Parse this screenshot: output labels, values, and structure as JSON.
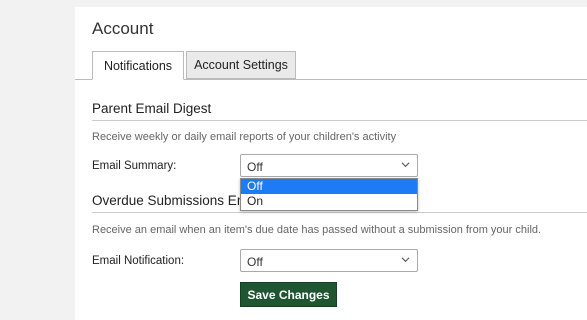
{
  "page": {
    "title": "Account"
  },
  "tabs": [
    {
      "label": "Notifications",
      "active": true
    },
    {
      "label": "Account Settings",
      "active": false
    }
  ],
  "sections": [
    {
      "title": "Parent Email Digest",
      "help": "Receive weekly or daily email reports of your children's activity",
      "field_label": "Email Summary:",
      "select_value": "Off"
    },
    {
      "title": "Overdue Submissions Email",
      "help": "Receive an email when an item's due date has passed without a submission from your child.",
      "field_label": "Email Notification:",
      "select_value": "Off"
    }
  ],
  "dropdown": {
    "options": [
      {
        "label": "Off",
        "highlighted": true
      },
      {
        "label": "On",
        "highlighted": false
      }
    ]
  },
  "actions": {
    "save_label": "Save Changes"
  },
  "colors": {
    "save_button_bg": "#1e5631",
    "highlight": "#1f7af5"
  }
}
